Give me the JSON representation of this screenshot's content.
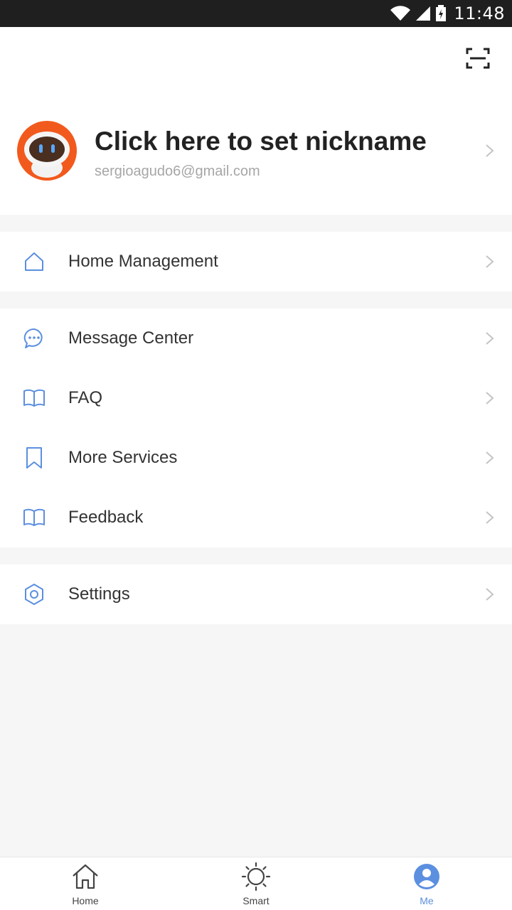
{
  "status_bar": {
    "time": "11:48"
  },
  "profile": {
    "nickname": "Click here to set nickname",
    "email": "sergioagudo6@gmail.com"
  },
  "groups": [
    {
      "items": [
        {
          "label": "Home Management",
          "icon": "home-icon"
        }
      ]
    },
    {
      "items": [
        {
          "label": "Message Center",
          "icon": "message-icon"
        },
        {
          "label": "FAQ",
          "icon": "book-icon"
        },
        {
          "label": "More Services",
          "icon": "bookmark-icon"
        },
        {
          "label": "Feedback",
          "icon": "book-icon"
        }
      ]
    },
    {
      "items": [
        {
          "label": "Settings",
          "icon": "settings-icon"
        }
      ]
    }
  ],
  "tabbar": {
    "tabs": [
      {
        "label": "Home",
        "icon": "home-icon",
        "active": false
      },
      {
        "label": "Smart",
        "icon": "sun-icon",
        "active": false
      },
      {
        "label": "Me",
        "icon": "user-icon",
        "active": true
      }
    ]
  },
  "colors": {
    "accent": "#5b8fe0",
    "avatar": "#f25a1d",
    "background": "#f6f6f6"
  }
}
